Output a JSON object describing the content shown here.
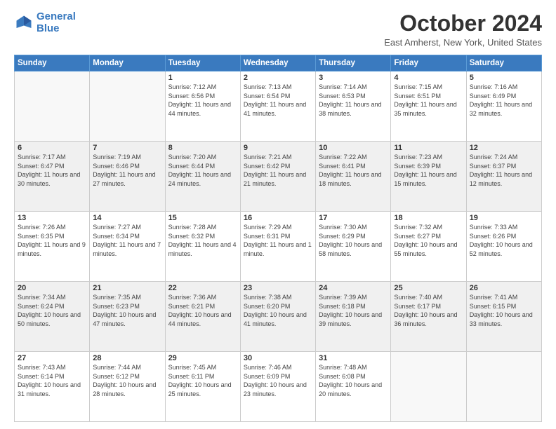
{
  "logo": {
    "line1": "General",
    "line2": "Blue"
  },
  "header": {
    "month": "October 2024",
    "location": "East Amherst, New York, United States"
  },
  "weekdays": [
    "Sunday",
    "Monday",
    "Tuesday",
    "Wednesday",
    "Thursday",
    "Friday",
    "Saturday"
  ],
  "weeks": [
    [
      {
        "day": "",
        "info": ""
      },
      {
        "day": "",
        "info": ""
      },
      {
        "day": "1",
        "info": "Sunrise: 7:12 AM\nSunset: 6:56 PM\nDaylight: 11 hours and 44 minutes."
      },
      {
        "day": "2",
        "info": "Sunrise: 7:13 AM\nSunset: 6:54 PM\nDaylight: 11 hours and 41 minutes."
      },
      {
        "day": "3",
        "info": "Sunrise: 7:14 AM\nSunset: 6:53 PM\nDaylight: 11 hours and 38 minutes."
      },
      {
        "day": "4",
        "info": "Sunrise: 7:15 AM\nSunset: 6:51 PM\nDaylight: 11 hours and 35 minutes."
      },
      {
        "day": "5",
        "info": "Sunrise: 7:16 AM\nSunset: 6:49 PM\nDaylight: 11 hours and 32 minutes."
      }
    ],
    [
      {
        "day": "6",
        "info": "Sunrise: 7:17 AM\nSunset: 6:47 PM\nDaylight: 11 hours and 30 minutes."
      },
      {
        "day": "7",
        "info": "Sunrise: 7:19 AM\nSunset: 6:46 PM\nDaylight: 11 hours and 27 minutes."
      },
      {
        "day": "8",
        "info": "Sunrise: 7:20 AM\nSunset: 6:44 PM\nDaylight: 11 hours and 24 minutes."
      },
      {
        "day": "9",
        "info": "Sunrise: 7:21 AM\nSunset: 6:42 PM\nDaylight: 11 hours and 21 minutes."
      },
      {
        "day": "10",
        "info": "Sunrise: 7:22 AM\nSunset: 6:41 PM\nDaylight: 11 hours and 18 minutes."
      },
      {
        "day": "11",
        "info": "Sunrise: 7:23 AM\nSunset: 6:39 PM\nDaylight: 11 hours and 15 minutes."
      },
      {
        "day": "12",
        "info": "Sunrise: 7:24 AM\nSunset: 6:37 PM\nDaylight: 11 hours and 12 minutes."
      }
    ],
    [
      {
        "day": "13",
        "info": "Sunrise: 7:26 AM\nSunset: 6:35 PM\nDaylight: 11 hours and 9 minutes."
      },
      {
        "day": "14",
        "info": "Sunrise: 7:27 AM\nSunset: 6:34 PM\nDaylight: 11 hours and 7 minutes."
      },
      {
        "day": "15",
        "info": "Sunrise: 7:28 AM\nSunset: 6:32 PM\nDaylight: 11 hours and 4 minutes."
      },
      {
        "day": "16",
        "info": "Sunrise: 7:29 AM\nSunset: 6:31 PM\nDaylight: 11 hours and 1 minute."
      },
      {
        "day": "17",
        "info": "Sunrise: 7:30 AM\nSunset: 6:29 PM\nDaylight: 10 hours and 58 minutes."
      },
      {
        "day": "18",
        "info": "Sunrise: 7:32 AM\nSunset: 6:27 PM\nDaylight: 10 hours and 55 minutes."
      },
      {
        "day": "19",
        "info": "Sunrise: 7:33 AM\nSunset: 6:26 PM\nDaylight: 10 hours and 52 minutes."
      }
    ],
    [
      {
        "day": "20",
        "info": "Sunrise: 7:34 AM\nSunset: 6:24 PM\nDaylight: 10 hours and 50 minutes."
      },
      {
        "day": "21",
        "info": "Sunrise: 7:35 AM\nSunset: 6:23 PM\nDaylight: 10 hours and 47 minutes."
      },
      {
        "day": "22",
        "info": "Sunrise: 7:36 AM\nSunset: 6:21 PM\nDaylight: 10 hours and 44 minutes."
      },
      {
        "day": "23",
        "info": "Sunrise: 7:38 AM\nSunset: 6:20 PM\nDaylight: 10 hours and 41 minutes."
      },
      {
        "day": "24",
        "info": "Sunrise: 7:39 AM\nSunset: 6:18 PM\nDaylight: 10 hours and 39 minutes."
      },
      {
        "day": "25",
        "info": "Sunrise: 7:40 AM\nSunset: 6:17 PM\nDaylight: 10 hours and 36 minutes."
      },
      {
        "day": "26",
        "info": "Sunrise: 7:41 AM\nSunset: 6:15 PM\nDaylight: 10 hours and 33 minutes."
      }
    ],
    [
      {
        "day": "27",
        "info": "Sunrise: 7:43 AM\nSunset: 6:14 PM\nDaylight: 10 hours and 31 minutes."
      },
      {
        "day": "28",
        "info": "Sunrise: 7:44 AM\nSunset: 6:12 PM\nDaylight: 10 hours and 28 minutes."
      },
      {
        "day": "29",
        "info": "Sunrise: 7:45 AM\nSunset: 6:11 PM\nDaylight: 10 hours and 25 minutes."
      },
      {
        "day": "30",
        "info": "Sunrise: 7:46 AM\nSunset: 6:09 PM\nDaylight: 10 hours and 23 minutes."
      },
      {
        "day": "31",
        "info": "Sunrise: 7:48 AM\nSunset: 6:08 PM\nDaylight: 10 hours and 20 minutes."
      },
      {
        "day": "",
        "info": ""
      },
      {
        "day": "",
        "info": ""
      }
    ]
  ],
  "shaded_rows": [
    1,
    3
  ]
}
